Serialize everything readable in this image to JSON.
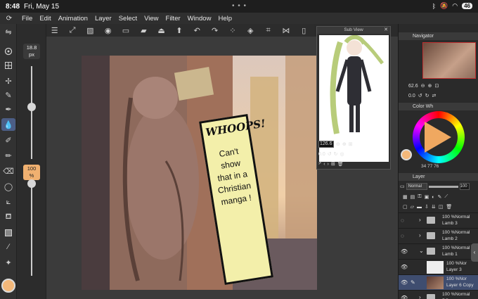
{
  "status": {
    "time": "8:48",
    "date": "Fri, May 15",
    "battery": "46"
  },
  "menu": {
    "items": [
      "File",
      "Edit",
      "Animation",
      "Layer",
      "Select",
      "View",
      "Filter",
      "Window",
      "Help"
    ]
  },
  "brush": {
    "size_value": "18.8",
    "size_unit": "px",
    "opacity_value": "100",
    "opacity_unit": "%"
  },
  "bubble": {
    "title": "WHOOPS!",
    "body_lines": [
      "Can't show",
      "that in a",
      "Christian",
      "manga !"
    ]
  },
  "subview": {
    "title": "Sub View",
    "zoom": "126.6",
    "angle": "0.0"
  },
  "navigator": {
    "title": "Navigator",
    "zoom": "62.6",
    "angle": "0.0"
  },
  "color": {
    "title": "Color Wh",
    "main_color": "#f4b87a",
    "values": "34    77    76"
  },
  "layers": {
    "title": "Layer",
    "blend_mode": "Normal",
    "opacity": "100",
    "rows": [
      {
        "mode": "100 %Normal",
        "name": "Lamb 3"
      },
      {
        "mode": "100 %Normal",
        "name": "Lamb 2"
      },
      {
        "mode": "100 %Normal",
        "name": "Lamb 1"
      },
      {
        "mode": "100 %Nor",
        "name": "Layer 3"
      },
      {
        "mode": "100 %Nor",
        "name": "Layer 6 Copy"
      },
      {
        "mode": "100 %Normal",
        "name": "BG"
      }
    ]
  },
  "colors": {
    "accent": "#4c5e86",
    "bubble_bg": "#f3efaa",
    "selected_row": "#3f4d6f"
  }
}
